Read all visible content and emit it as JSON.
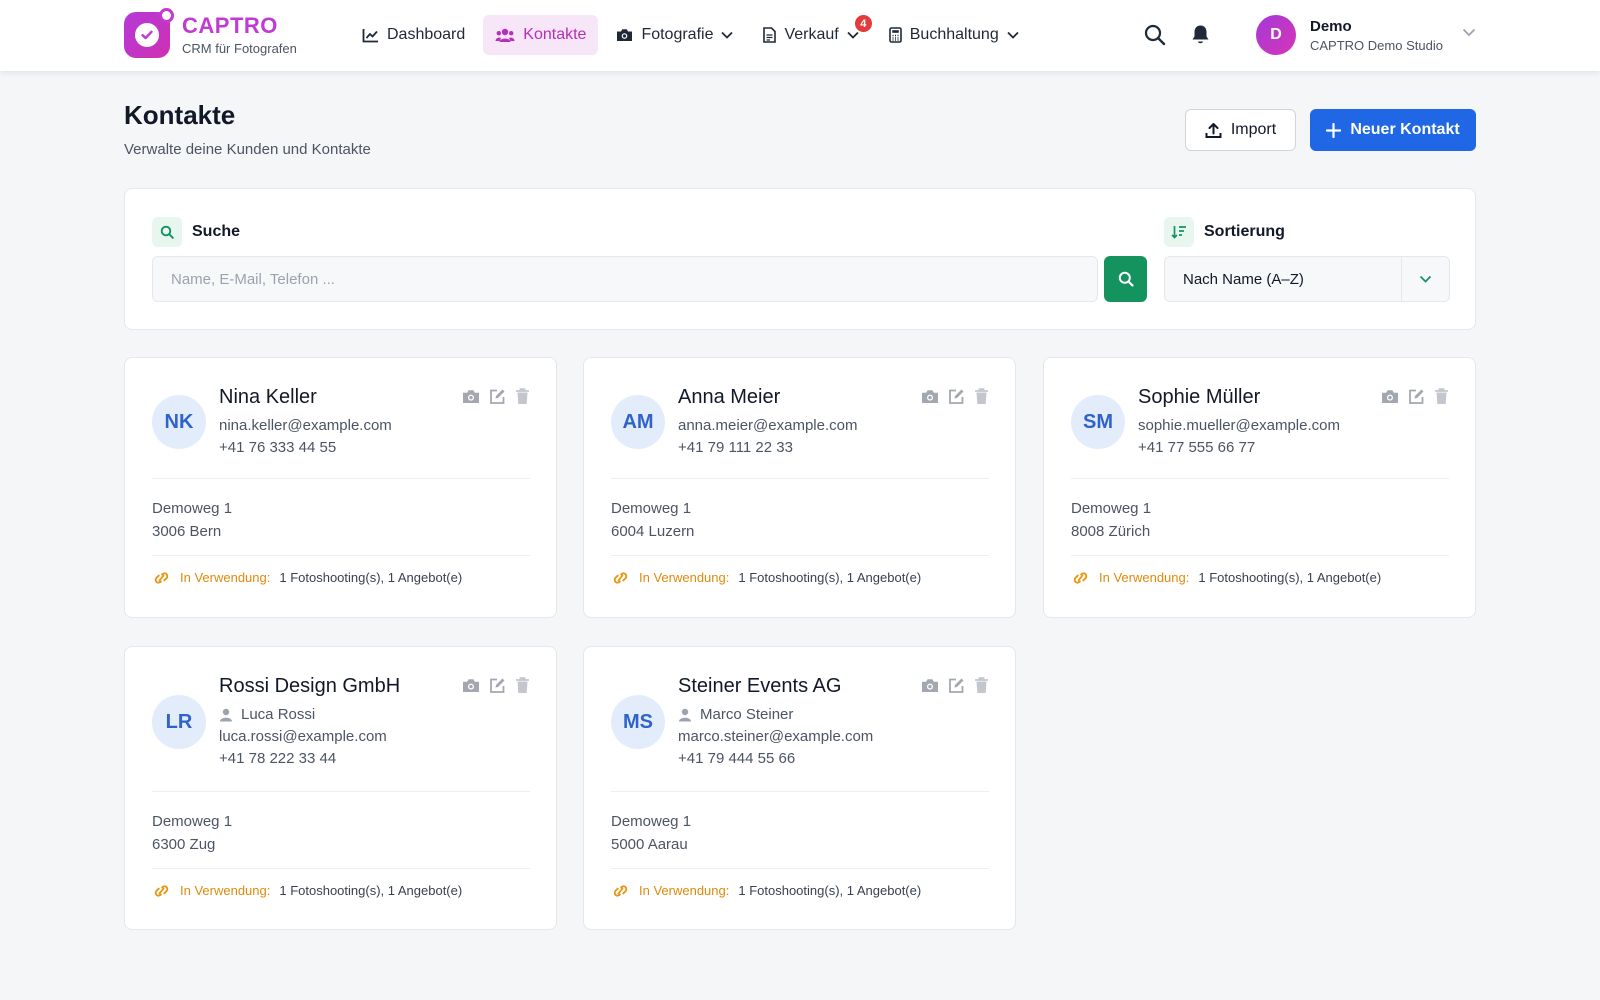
{
  "app": {
    "name": "CAPTRO",
    "tagline": "CRM für Fotografen"
  },
  "nav": {
    "dashboard": "Dashboard",
    "kontakte": "Kontakte",
    "fotografie": "Fotografie",
    "verkauf": "Verkauf",
    "verkauf_badge": "4",
    "buchhaltung": "Buchhaltung"
  },
  "user": {
    "initial": "D",
    "name": "Demo",
    "studio": "CAPTRO Demo Studio"
  },
  "page": {
    "title": "Kontakte",
    "subtitle": "Verwalte deine Kunden und Kontakte"
  },
  "actions": {
    "import": "Import",
    "new_contact": "Neuer Kontakt"
  },
  "filter": {
    "search_label": "Suche",
    "search_placeholder": "Name, E-Mail, Telefon ...",
    "sort_label": "Sortierung",
    "sort_value": "Nach Name (A–Z)"
  },
  "usage_label": "In Verwendung:",
  "contacts": [
    {
      "initials": "NK",
      "name": "Nina Keller",
      "person": "",
      "email": "nina.keller@example.com",
      "phone": "+41 76 333 44 55",
      "street": "Demoweg 1",
      "city": "3006 Bern",
      "usage": "1 Fotoshooting(s), 1 Angebot(e)"
    },
    {
      "initials": "AM",
      "name": "Anna Meier",
      "person": "",
      "email": "anna.meier@example.com",
      "phone": "+41 79 111 22 33",
      "street": "Demoweg 1",
      "city": "6004 Luzern",
      "usage": "1 Fotoshooting(s), 1 Angebot(e)"
    },
    {
      "initials": "SM",
      "name": "Sophie Müller",
      "person": "",
      "email": "sophie.mueller@example.com",
      "phone": "+41 77 555 66 77",
      "street": "Demoweg 1",
      "city": "8008 Zürich",
      "usage": "1 Fotoshooting(s), 1 Angebot(e)"
    },
    {
      "initials": "LR",
      "name": "Rossi Design GmbH",
      "person": "Luca Rossi",
      "email": "luca.rossi@example.com",
      "phone": "+41 78 222 33 44",
      "street": "Demoweg 1",
      "city": "6300 Zug",
      "usage": "1 Fotoshooting(s), 1 Angebot(e)"
    },
    {
      "initials": "MS",
      "name": "Steiner Events AG",
      "person": "Marco Steiner",
      "email": "marco.steiner@example.com",
      "phone": "+41 79 444 55 66",
      "street": "Demoweg 1",
      "city": "5000 Aarau",
      "usage": "1 Fotoshooting(s), 1 Angebot(e)"
    }
  ]
}
